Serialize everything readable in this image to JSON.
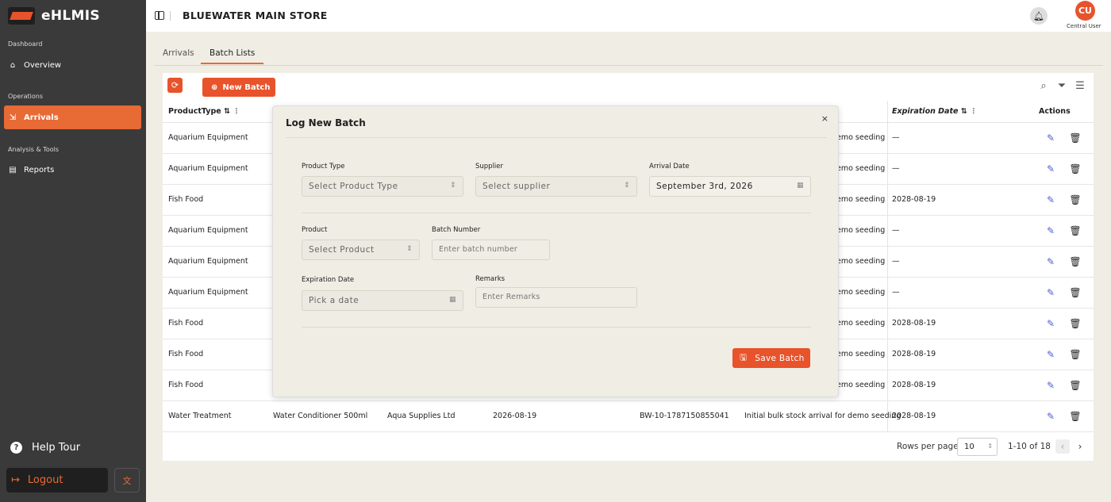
{
  "app": {
    "name": "eHLMIS",
    "store_title": "BLUEWATER MAIN STORE"
  },
  "user": {
    "initials": "CU",
    "name": "Central User"
  },
  "sidebar": {
    "sections": [
      {
        "label": "Dashboard"
      },
      {
        "label": "Operations"
      },
      {
        "label": "Analysis & Tools"
      }
    ],
    "items": [
      {
        "label": "Overview",
        "icon": "home-icon"
      },
      {
        "label": "Arrivals",
        "icon": "arrivals-icon",
        "active": true
      },
      {
        "label": "Reports",
        "icon": "document-icon"
      }
    ],
    "help_tour": "Help Tour",
    "logout": "Logout"
  },
  "tabs": [
    {
      "label": "Arrivals"
    },
    {
      "label": "Batch Lists",
      "active": true
    }
  ],
  "toolbar": {
    "new_batch": "New Batch"
  },
  "table": {
    "headers": {
      "product_type": "ProductType",
      "expiration_date": "Expiration Date",
      "actions": "Actions"
    },
    "rows": [
      {
        "product_type": "Aquarium Equipment",
        "remarks": "emo seeding",
        "expiration": "—"
      },
      {
        "product_type": "Aquarium Equipment",
        "remarks": "emo seeding",
        "expiration": "—"
      },
      {
        "product_type": "Fish Food",
        "remarks": "emo seeding",
        "expiration": "2028-08-19"
      },
      {
        "product_type": "Aquarium Equipment",
        "remarks": "emo seeding",
        "expiration": "—"
      },
      {
        "product_type": "Aquarium Equipment",
        "remarks": "emo seeding",
        "expiration": "—"
      },
      {
        "product_type": "Aquarium Equipment",
        "remarks": "emo seeding",
        "expiration": "—"
      },
      {
        "product_type": "Fish Food",
        "remarks": "emo seeding",
        "expiration": "2028-08-19"
      },
      {
        "product_type": "Fish Food",
        "remarks": "emo seeding",
        "expiration": "2028-08-19"
      },
      {
        "product_type": "Fish Food",
        "remarks": "emo seeding",
        "expiration": "2028-08-19"
      },
      {
        "product_type": "Water Treatment",
        "product": "Water Conditioner 500ml",
        "supplier": "Aqua Supplies Ltd",
        "arrival": "2026-08-19",
        "batch": "BW-10-1787150855041",
        "remarks": "Initial bulk stock arrival for demo seeding",
        "expiration": "2028-08-19"
      }
    ]
  },
  "pagination": {
    "rows_per_page_label": "Rows per page",
    "rows_per_page": "10",
    "range": "1-10 of 18"
  },
  "modal": {
    "title": "Log New Batch",
    "close": "×",
    "fields": {
      "product_type": {
        "label": "Product Type",
        "placeholder": "Select Product Type"
      },
      "supplier": {
        "label": "Supplier",
        "placeholder": "Select supplier"
      },
      "arrival_date": {
        "label": "Arrival Date",
        "value": "September 3rd, 2026"
      },
      "product": {
        "label": "Product",
        "placeholder": "Select Product"
      },
      "batch_number": {
        "label": "Batch Number",
        "placeholder": "Enter batch number"
      },
      "expiration_date": {
        "label": "Expiration Date",
        "placeholder": "Pick a date"
      },
      "remarks": {
        "label": "Remarks",
        "placeholder": "Enter Remarks"
      }
    },
    "save": "Save Batch"
  },
  "colors": {
    "accent": "#e8532b",
    "sidebar": "#3a3a3a",
    "edit": "#4f5bd5"
  }
}
